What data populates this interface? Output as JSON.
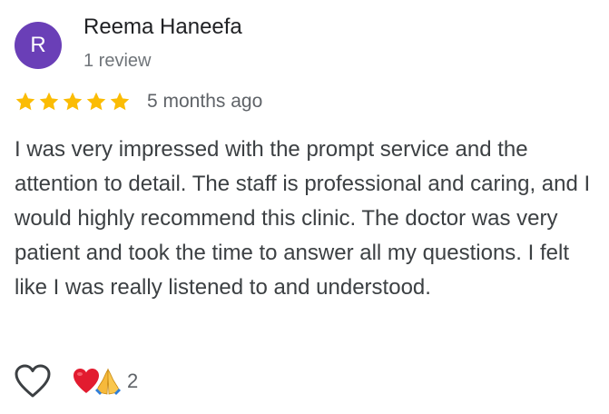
{
  "reviewer": {
    "initial": "R",
    "name": "Reema Haneefa",
    "review_count": "1 review",
    "avatar_color": "#6a3fb7"
  },
  "rating": {
    "stars": 5,
    "max": 5,
    "star_color": "#fbbc04",
    "date": "5 months ago"
  },
  "review": {
    "text": "I was very impressed with the prompt service and the attention to detail. The staff is professional and caring, and I would highly recommend this clinic. The doctor was very patient and took the time to answer all my questions. I felt like I was really listened to and understood."
  },
  "reactions": {
    "like_icon": "heart-outline-icon",
    "emojis": [
      "red-heart-emoji",
      "folded-hands-emoji"
    ],
    "count": "2"
  }
}
